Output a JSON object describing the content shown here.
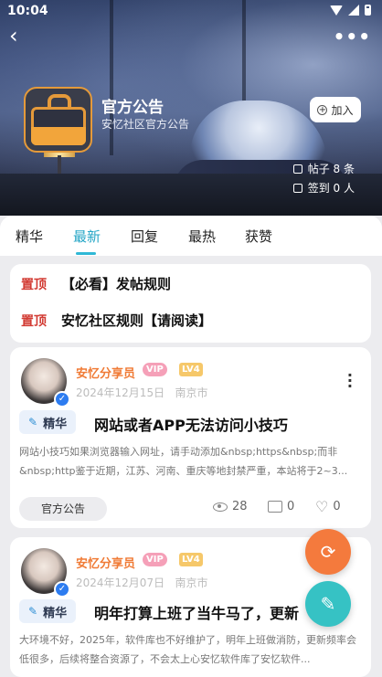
{
  "status_bar": {
    "time": "10:04"
  },
  "group": {
    "title": "官方公告",
    "subtitle": "安忆社区官方公告",
    "join_label": "加入",
    "posts_stat": "帖子 8 条",
    "checkin_stat": "签到 0 人"
  },
  "tabs": [
    {
      "label": "精华",
      "active": false
    },
    {
      "label": "最新",
      "active": true
    },
    {
      "label": "回复",
      "active": false
    },
    {
      "label": "最热",
      "active": false
    },
    {
      "label": "获赞",
      "active": false
    }
  ],
  "pinned": [
    {
      "tag": "置顶",
      "title": "【必看】发帖规则"
    },
    {
      "tag": "置顶",
      "title": "安忆社区规则【请阅读】"
    }
  ],
  "posts": [
    {
      "author": "安忆分享员",
      "vip": "VIP",
      "level": "LV4",
      "date": "2024年12月15日",
      "location": "南京市",
      "badge": "精华",
      "title": "网站或者APP无法访问小技巧",
      "excerpt": "网站小技巧如果浏览器输入网址，请手动添加&nbsp;https&nbsp;而非&nbsp;http鉴于近期，江苏、河南、重庆等地封禁严重，本站将于2~3...",
      "category": "官方公告",
      "views": "28",
      "comments": "0",
      "likes": "0"
    },
    {
      "author": "安忆分享员",
      "vip": "VIP",
      "level": "LV4",
      "date": "2024年12月07日",
      "location": "南京市",
      "badge": "精华",
      "title": "明年打算上班了当牛马了，更新",
      "excerpt": "大环境不好，2025年，软件库也不好维护了，明年上班做消防，更新频率会低很多，后续将整合资源了，不会太上心安忆软件库了安忆软件..."
    }
  ],
  "colors": {
    "accent": "#2fb8d6",
    "pin": "#d23b33",
    "author": "#f07b36",
    "refresh_fab": "#f47a3d",
    "edit_fab": "#36c2c4"
  }
}
